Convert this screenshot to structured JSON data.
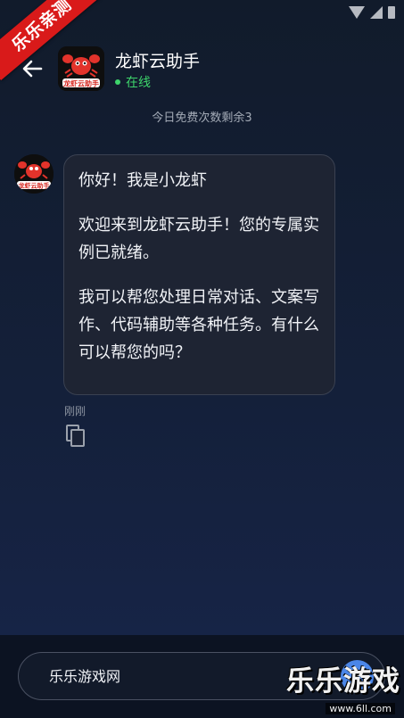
{
  "promo": {
    "ribbon_text": "乐乐亲测"
  },
  "header": {
    "app_name": "龙虾云助手",
    "status": "在线",
    "status_color": "#3ed46b",
    "avatar_logo_text": "龙虾云助手",
    "back_icon": "arrow-left-icon"
  },
  "quota_notice": "今日免费次数剩余3",
  "conversation": {
    "message": {
      "paragraphs": [
        "你好！我是小龙虾",
        "欢迎来到龙虾云助手！您的专属实例已就绪。",
        "我可以帮您处理日常对话、文案写作、代码辅助等各种任务。有什么可以帮您的吗？"
      ],
      "time": "刚刚",
      "copy_icon": "copy-icon"
    },
    "bot_avatar_logo_text": "龙虾云助手"
  },
  "composer": {
    "input_value": "乐乐游戏网",
    "send_icon": "arrow-up-icon",
    "accent": "#4b86e8"
  },
  "watermark": {
    "logo": "乐乐游戏",
    "url": "www.6ll.com"
  }
}
